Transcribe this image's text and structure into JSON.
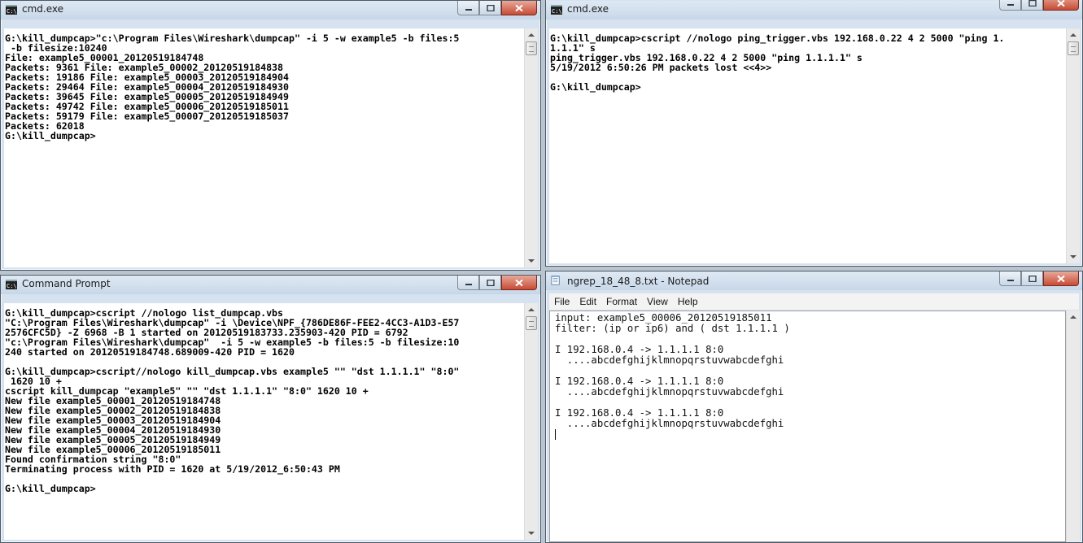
{
  "windows": {
    "cmd1": {
      "title": "cmd.exe",
      "lines": [
        "G:\\kill_dumpcap>\"c:\\Program Files\\Wireshark\\dumpcap\" -i 5 -w example5 -b files:5",
        " -b filesize:10240",
        "File: example5_00001_20120519184748",
        "Packets: 9361 File: example5_00002_20120519184838",
        "Packets: 19186 File: example5_00003_20120519184904",
        "Packets: 29464 File: example5_00004_20120519184930",
        "Packets: 39645 File: example5_00005_20120519184949",
        "Packets: 49742 File: example5_00006_20120519185011",
        "Packets: 59179 File: example5_00007_20120519185037",
        "Packets: 62018",
        "G:\\kill_dumpcap>"
      ]
    },
    "cmd2": {
      "title": "cmd.exe",
      "lines": [
        "G:\\kill_dumpcap>cscript //nologo ping_trigger.vbs 192.168.0.22 4 2 5000 \"ping 1.",
        "1.1.1\" s",
        "ping_trigger.vbs 192.168.0.22 4 2 5000 \"ping 1.1.1.1\" s",
        "5/19/2012 6:50:26 PM packets lost <<4>>",
        "",
        "G:\\kill_dumpcap>"
      ]
    },
    "cmd3": {
      "title": "Command Prompt",
      "lines": [
        "G:\\kill_dumpcap>cscript //nologo list_dumpcap.vbs",
        "\"C:\\Program Files\\Wireshark\\dumpcap\" -i \\Device\\NPF_{786DE86F-FEE2-4CC3-A1D3-E57",
        "2576CFC5D} -Z 6968 -B 1 started on 20120519183733.235903-420 PID = 6792",
        "\"c:\\Program Files\\Wireshark\\dumpcap\"  -i 5 -w example5 -b files:5 -b filesize:10",
        "240 started on 20120519184748.689009-420 PID = 1620",
        "",
        "G:\\kill_dumpcap>cscript//nologo kill_dumpcap.vbs example5 \"\" \"dst 1.1.1.1\" \"8:0\"",
        " 1620 10 +",
        "cscript kill_dumpcap \"example5\" \"\" \"dst 1.1.1.1\" \"8:0\" 1620 10 +",
        "New file example5_00001_20120519184748",
        "New file example5_00002_20120519184838",
        "New file example5_00003_20120519184904",
        "New file example5_00004_20120519184930",
        "New file example5_00005_20120519184949",
        "New file example5_00006_20120519185011",
        "Found confirmation string \"8:0\"",
        "Terminating process with PID = 1620 at 5/19/2012_6:50:43 PM",
        "",
        "G:\\kill_dumpcap>"
      ]
    },
    "notepad": {
      "title": "ngrep_18_48_8.txt - Notepad",
      "menu": [
        "File",
        "Edit",
        "Format",
        "View",
        "Help"
      ],
      "lines": [
        "input: example5_00006_20120519185011",
        "filter: (ip or ip6) and ( dst 1.1.1.1 )",
        "",
        "I 192.168.0.4 -> 1.1.1.1 8:0",
        "  ....abcdefghijklmnopqrstuvwabcdefghi",
        "",
        "I 192.168.0.4 -> 1.1.1.1 8:0",
        "  ....abcdefghijklmnopqrstuvwabcdefghi",
        "",
        "I 192.168.0.4 -> 1.1.1.1 8:0",
        "  ....abcdefghijklmnopqrstuvwabcdefghi"
      ]
    }
  },
  "icons": {
    "console": "console-icon",
    "notepad": "notepad-icon",
    "minimize": "minimize-icon",
    "maximize": "maximize-icon",
    "close": "close-icon"
  },
  "colors": {
    "title_bar": "#d6e2ef",
    "close_button": "#c74b35",
    "console_text": "#000000",
    "console_bg": "#ffffff"
  }
}
